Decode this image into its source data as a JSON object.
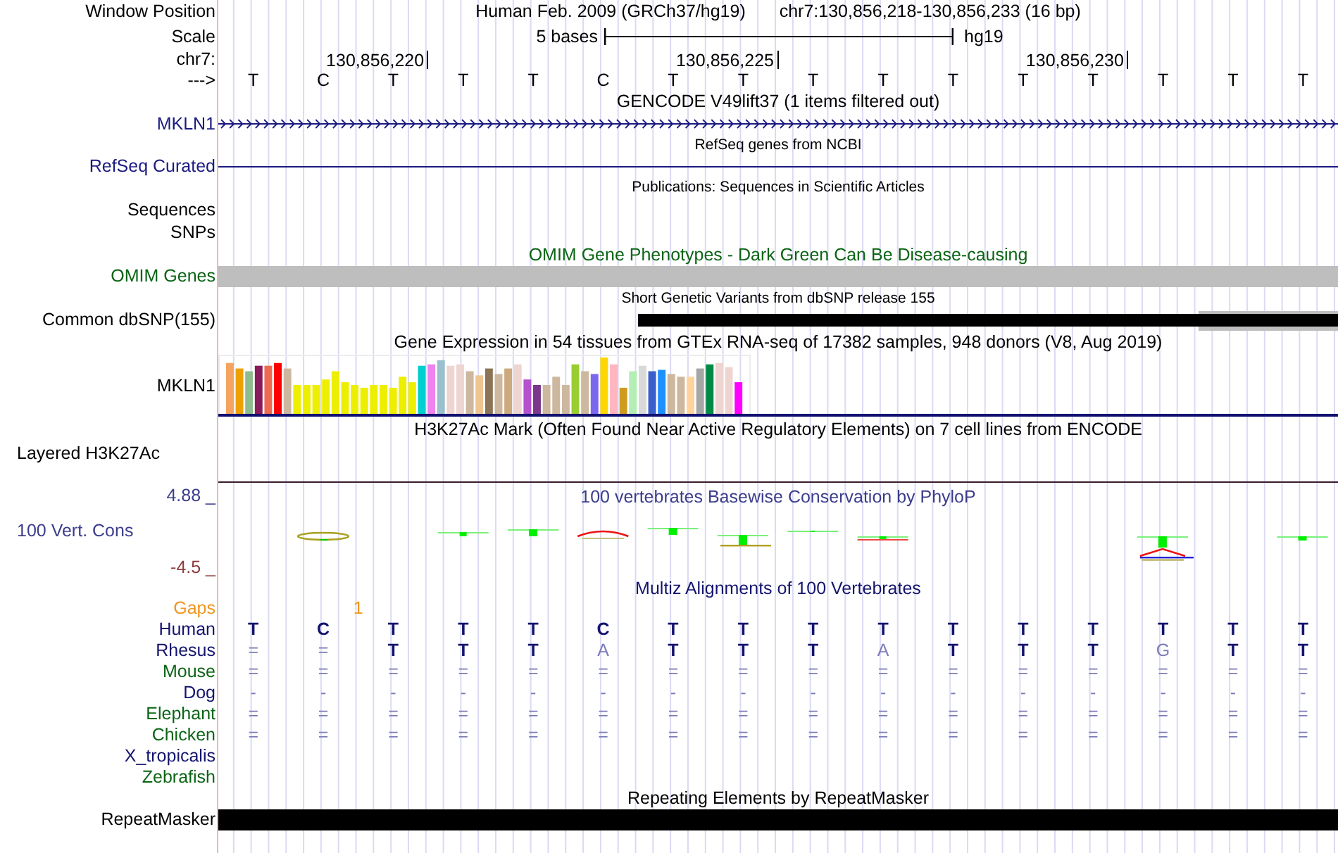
{
  "window_position": {
    "label": "Window Position",
    "title": "Human Feb. 2009 (GRCh37/hg19)",
    "position": "chr7:130,856,218-130,856,233 (16 bp)"
  },
  "scale": {
    "label": "Scale",
    "text": "5 bases",
    "assembly": "hg19"
  },
  "coordinates": {
    "label": "chr7:",
    "ticks": [
      "130,856,220",
      "130,856,225",
      "130,856,230"
    ]
  },
  "sequence": {
    "label": "--->",
    "bases": [
      "T",
      "C",
      "T",
      "T",
      "T",
      "C",
      "T",
      "T",
      "T",
      "T",
      "T",
      "T",
      "T",
      "T",
      "T",
      "T"
    ]
  },
  "tracks": [
    {
      "kind": "gene",
      "title": "GENCODE V49lift37 (1 items filtered out)",
      "label": "MKLN1",
      "color": "#1a1a80"
    },
    {
      "kind": "line",
      "title": "RefSeq genes from NCBI",
      "label": "RefSeq Curated",
      "color": "#1a1a80"
    },
    {
      "kind": "text-rows",
      "title": "Publications: Sequences in Scientific Articles",
      "labels": [
        "Sequences",
        "SNPs"
      ]
    },
    {
      "kind": "bar",
      "title": "OMIM Gene Phenotypes - Dark Green Can Be Disease-causing",
      "label": "OMIM Genes",
      "color": "#0a6414"
    },
    {
      "kind": "snp",
      "title": "Short Genetic Variants from dbSNP release 155",
      "label": "Common dbSNP(155)"
    },
    {
      "kind": "expression",
      "title": "Gene Expression in 54 tissues from GTEx RNA-seq of 17382 samples, 948 donors (V8, Aug 2019)",
      "label": "MKLN1"
    },
    {
      "kind": "signal",
      "title": "H3K27Ac Mark (Often Found Near Active Regulatory Elements) on 7 cell lines from ENCODE",
      "label": "Layered H3K27Ac"
    },
    {
      "kind": "conservation",
      "title": "100 vertebrates Basewise Conservation by PhyloP",
      "label": "100 Vert. Cons",
      "max": "4.88 _",
      "min": "-4.5 _",
      "color": "#3c3c8c"
    },
    {
      "kind": "alignment",
      "title": "Multiz Alignments of 100 Vertebrates",
      "color": "#14146e",
      "gaps": {
        "label": "Gaps",
        "value": "1"
      },
      "species": [
        {
          "name": "Human",
          "color": "#14146e",
          "cells": [
            {
              "text": "T",
              "strong": true
            },
            {
              "text": "C",
              "strong": true
            },
            {
              "text": "T",
              "strong": true
            },
            {
              "text": "T",
              "strong": true
            },
            {
              "text": "T",
              "strong": true
            },
            {
              "text": "C",
              "strong": true
            },
            {
              "text": "T",
              "strong": true
            },
            {
              "text": "T",
              "strong": true
            },
            {
              "text": "T",
              "strong": true
            },
            {
              "text": "T",
              "strong": true
            },
            {
              "text": "T",
              "strong": true
            },
            {
              "text": "T",
              "strong": true
            },
            {
              "text": "T",
              "strong": true
            },
            {
              "text": "T",
              "strong": true
            },
            {
              "text": "T",
              "strong": true
            },
            {
              "text": "T",
              "strong": true
            }
          ]
        },
        {
          "name": "Rhesus",
          "color": "#14146e",
          "cells": [
            {
              "text": "=",
              "strong": false
            },
            {
              "text": "=",
              "strong": false
            },
            {
              "text": "T",
              "strong": true
            },
            {
              "text": "T",
              "strong": true
            },
            {
              "text": "T",
              "strong": true
            },
            {
              "text": "A",
              "strong": false
            },
            {
              "text": "T",
              "strong": true
            },
            {
              "text": "T",
              "strong": true
            },
            {
              "text": "T",
              "strong": true
            },
            {
              "text": "A",
              "strong": false
            },
            {
              "text": "T",
              "strong": true
            },
            {
              "text": "T",
              "strong": true
            },
            {
              "text": "T",
              "strong": true
            },
            {
              "text": "G",
              "strong": false
            },
            {
              "text": "T",
              "strong": true
            },
            {
              "text": "T",
              "strong": true
            }
          ]
        },
        {
          "name": "Mouse",
          "color": "#0a6414",
          "cells": [
            {
              "text": "=",
              "strong": false
            },
            {
              "text": "=",
              "strong": false
            },
            {
              "text": "=",
              "strong": false
            },
            {
              "text": "=",
              "strong": false
            },
            {
              "text": "=",
              "strong": false
            },
            {
              "text": "=",
              "strong": false
            },
            {
              "text": "=",
              "strong": false
            },
            {
              "text": "=",
              "strong": false
            },
            {
              "text": "=",
              "strong": false
            },
            {
              "text": "=",
              "strong": false
            },
            {
              "text": "=",
              "strong": false
            },
            {
              "text": "=",
              "strong": false
            },
            {
              "text": "=",
              "strong": false
            },
            {
              "text": "=",
              "strong": false
            },
            {
              "text": "=",
              "strong": false
            },
            {
              "text": "=",
              "strong": false
            }
          ]
        },
        {
          "name": "Dog",
          "color": "#14146e",
          "cells": [
            {
              "text": "-",
              "strong": false
            },
            {
              "text": "-",
              "strong": false
            },
            {
              "text": "-",
              "strong": false
            },
            {
              "text": "-",
              "strong": false
            },
            {
              "text": "-",
              "strong": false
            },
            {
              "text": "-",
              "strong": false
            },
            {
              "text": "-",
              "strong": false
            },
            {
              "text": "-",
              "strong": false
            },
            {
              "text": "-",
              "strong": false
            },
            {
              "text": "-",
              "strong": false
            },
            {
              "text": "-",
              "strong": false
            },
            {
              "text": "-",
              "strong": false
            },
            {
              "text": "-",
              "strong": false
            },
            {
              "text": "-",
              "strong": false
            },
            {
              "text": "-",
              "strong": false
            },
            {
              "text": "-",
              "strong": false
            }
          ]
        },
        {
          "name": "Elephant",
          "color": "#0a6414",
          "cells": [
            {
              "text": "=",
              "strong": false
            },
            {
              "text": "=",
              "strong": false
            },
            {
              "text": "=",
              "strong": false
            },
            {
              "text": "=",
              "strong": false
            },
            {
              "text": "=",
              "strong": false
            },
            {
              "text": "=",
              "strong": false
            },
            {
              "text": "=",
              "strong": false
            },
            {
              "text": "=",
              "strong": false
            },
            {
              "text": "=",
              "strong": false
            },
            {
              "text": "=",
              "strong": false
            },
            {
              "text": "=",
              "strong": false
            },
            {
              "text": "=",
              "strong": false
            },
            {
              "text": "=",
              "strong": false
            },
            {
              "text": "=",
              "strong": false
            },
            {
              "text": "=",
              "strong": false
            },
            {
              "text": "=",
              "strong": false
            }
          ]
        },
        {
          "name": "Chicken",
          "color": "#0a6414",
          "cells": [
            {
              "text": "=",
              "strong": false
            },
            {
              "text": "=",
              "strong": false
            },
            {
              "text": "=",
              "strong": false
            },
            {
              "text": "=",
              "strong": false
            },
            {
              "text": "=",
              "strong": false
            },
            {
              "text": "=",
              "strong": false
            },
            {
              "text": "=",
              "strong": false
            },
            {
              "text": "=",
              "strong": false
            },
            {
              "text": "=",
              "strong": false
            },
            {
              "text": "=",
              "strong": false
            },
            {
              "text": "=",
              "strong": false
            },
            {
              "text": "=",
              "strong": false
            },
            {
              "text": "=",
              "strong": false
            },
            {
              "text": "=",
              "strong": false
            },
            {
              "text": "=",
              "strong": false
            },
            {
              "text": "=",
              "strong": false
            }
          ]
        },
        {
          "name": "X_tropicalis",
          "color": "#14146e"
        },
        {
          "name": "Zebrafish",
          "color": "#0a6414"
        }
      ]
    },
    {
      "kind": "repeat",
      "title": "Repeating Elements by RepeatMasker",
      "label": "RepeatMasker"
    }
  ]
}
